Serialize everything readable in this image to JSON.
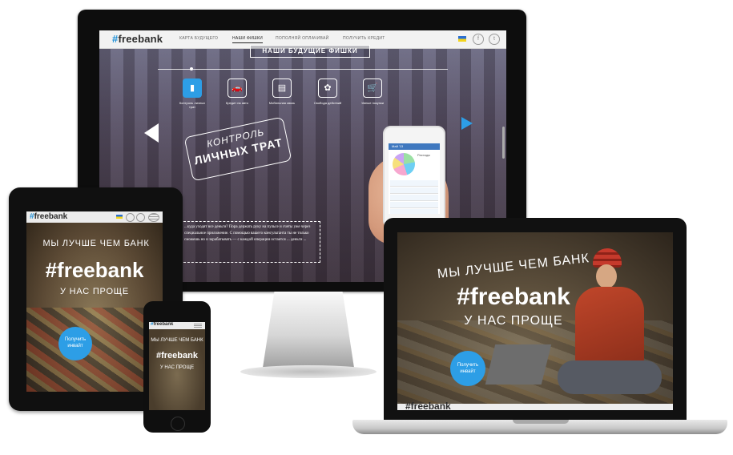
{
  "brand": {
    "hash": "#",
    "name": "freebank",
    "accent": "#2d9ee6"
  },
  "monitor": {
    "nav": [
      "КАРТА БУДУЩЕГО",
      "НАШИ ФИШКИ",
      "ПОПОЛНЯЙ ОПЛАЧИВАЙ",
      "ПОЛУЧИТЬ КРЕДИТ"
    ],
    "active_nav_index": 1,
    "social": [
      "f",
      "t"
    ],
    "section_title": "НАШИ БУДУЩИЕ ФИШКИ",
    "features": [
      {
        "icon": "card-icon",
        "glyph": "▮",
        "label": "Контроль личных трат",
        "selected": true
      },
      {
        "icon": "car-icon",
        "glyph": "🚗",
        "label": "Кредит на авто",
        "selected": false
      },
      {
        "icon": "document-icon",
        "glyph": "▤",
        "label": "Мобильная связь",
        "selected": false
      },
      {
        "icon": "gear-icon",
        "glyph": "✿",
        "label": "Свобода действий",
        "selected": false
      },
      {
        "icon": "basket-icon",
        "glyph": "🛒",
        "label": "Умные покупки",
        "selected": false
      }
    ],
    "badge_line1": "КОНТРОЛЬ",
    "badge_line2": "ЛИЧНЫХ ТРАТ",
    "body_text": "...куда уходят все деньги? Пора держать руку на пульсе и счеты уже через специальное приложение. С помощью вашего консультанта ты не только сможешь но и зарабатывать — с каждой операции остается ... деньги ..."
  },
  "phone_in_hand": {
    "header": "Май '13",
    "section": "Расходы"
  },
  "tablet": {
    "hero_line1": "МЫ ЛУЧШЕ ЧЕМ БАНК",
    "hero_line2": "#freebank",
    "hero_line3": "У НАС ПРОЩЕ",
    "cta": "Получить инвайт"
  },
  "phone": {
    "hero_line1": "МЫ ЛУЧШЕ ЧЕМ БАНК",
    "hero_line2": "#freebank",
    "hero_line3": "У НАС ПРОЩЕ"
  },
  "laptop": {
    "hero_line1": "МЫ ЛУЧШЕ ЧЕМ БАНК",
    "hero_line2": "#freebank",
    "hero_line3": "У НАС ПРОЩЕ",
    "cta": "Получить инвайт",
    "footer_logo": "#freebank"
  }
}
